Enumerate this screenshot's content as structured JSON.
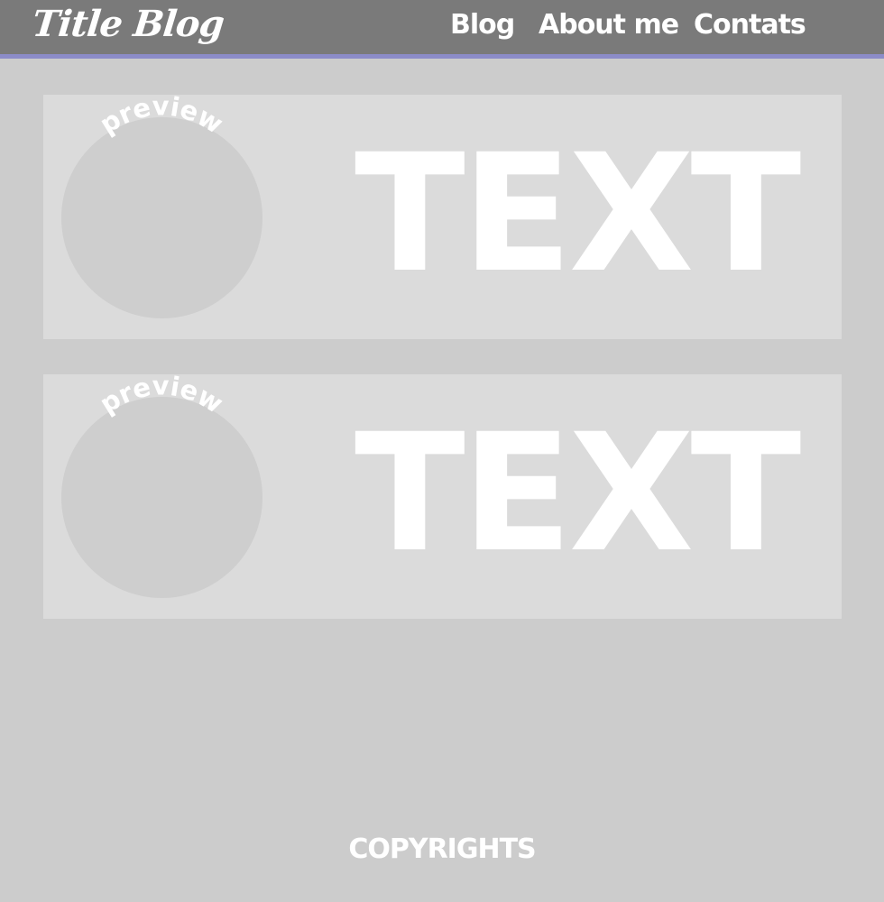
{
  "header": {
    "site_title": "Title Blog",
    "nav": {
      "blog": "Blog",
      "about": "About me",
      "contacts": "Contats"
    }
  },
  "posts": [
    {
      "preview_label": "preview",
      "text": "TEXT"
    },
    {
      "preview_label": "preview",
      "text": "TEXT"
    }
  ],
  "footer": {
    "copyright": "COPYRIGHTS"
  },
  "colors": {
    "header_bg": "#7a7a7a",
    "header_border": "#8c8cc8",
    "page_bg": "#cccccc",
    "card_bg": "#dbdbdb",
    "preview_circle": "#cecece",
    "text": "#ffffff"
  }
}
